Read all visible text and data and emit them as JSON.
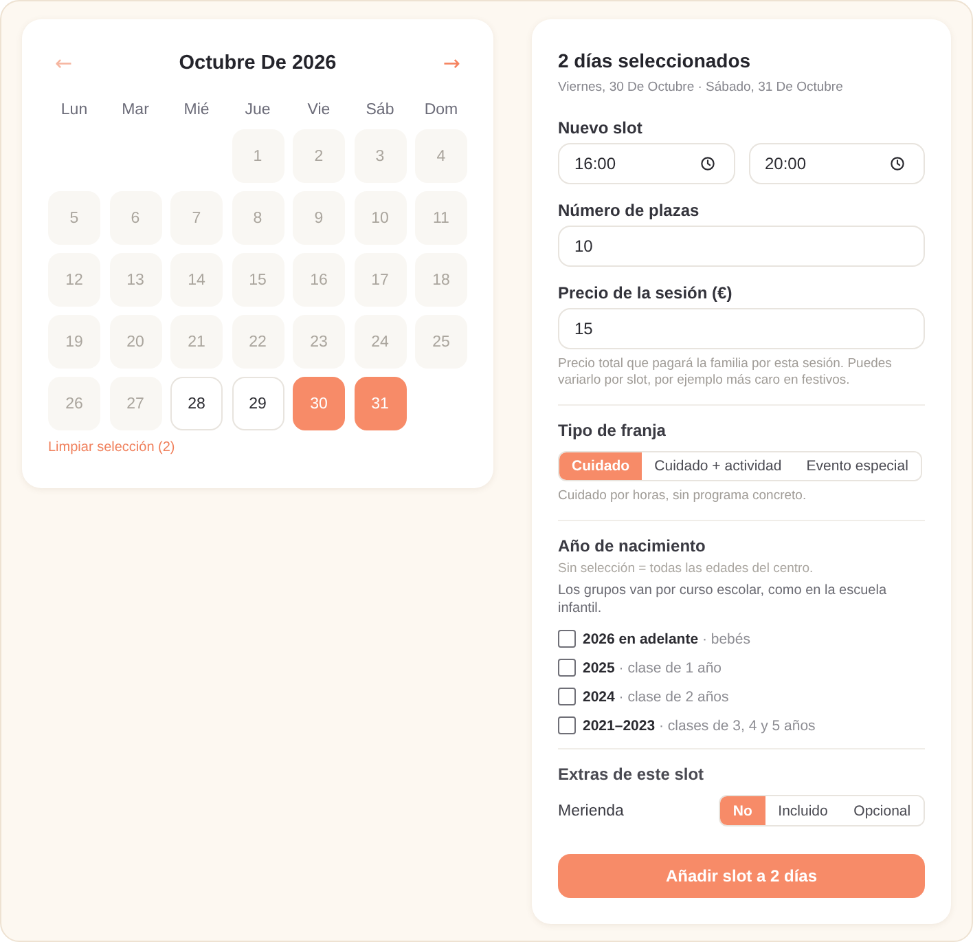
{
  "calendar": {
    "prev": {
      "symbol": "←",
      "disabled": true
    },
    "title": "Octubre De 2026",
    "next": {
      "symbol": "→",
      "disabled": false
    },
    "weekdays": [
      "Lun",
      "Mar",
      "Mié",
      "Jue",
      "Vie",
      "Sáb",
      "Dom"
    ],
    "weeks": [
      {
        "days": [
          {
            "label": "1",
            "disabled": true,
            "selected": false
          },
          {
            "label": "2",
            "disabled": true,
            "selected": false
          },
          {
            "label": "3",
            "disabled": true,
            "selected": false
          },
          {
            "label": "4",
            "disabled": true,
            "selected": false
          }
        ]
      },
      {
        "days": [
          {
            "label": "5",
            "disabled": true,
            "selected": false
          },
          {
            "label": "6",
            "disabled": true,
            "selected": false
          },
          {
            "label": "7",
            "disabled": true,
            "selected": false
          },
          {
            "label": "8",
            "disabled": true,
            "selected": false
          },
          {
            "label": "9",
            "disabled": true,
            "selected": false
          },
          {
            "label": "10",
            "disabled": true,
            "selected": false
          },
          {
            "label": "11",
            "disabled": true,
            "selected": false
          }
        ]
      },
      {
        "days": [
          {
            "label": "12",
            "disabled": true,
            "selected": false
          },
          {
            "label": "13",
            "disabled": true,
            "selected": false
          },
          {
            "label": "14",
            "disabled": true,
            "selected": false
          },
          {
            "label": "15",
            "disabled": true,
            "selected": false
          },
          {
            "label": "16",
            "disabled": true,
            "selected": false
          },
          {
            "label": "17",
            "disabled": true,
            "selected": false
          },
          {
            "label": "18",
            "disabled": true,
            "selected": false
          }
        ]
      },
      {
        "days": [
          {
            "label": "19",
            "disabled": true,
            "selected": false
          },
          {
            "label": "20",
            "disabled": true,
            "selected": false
          },
          {
            "label": "21",
            "disabled": true,
            "selected": false
          },
          {
            "label": "22",
            "disabled": true,
            "selected": false
          },
          {
            "label": "23",
            "disabled": true,
            "selected": false
          },
          {
            "label": "24",
            "disabled": true,
            "selected": false
          },
          {
            "label": "25",
            "disabled": true,
            "selected": false
          }
        ]
      },
      {
        "days": [
          {
            "label": "26",
            "disabled": true,
            "selected": false
          },
          {
            "label": "27",
            "disabled": true,
            "selected": false
          },
          {
            "label": "28",
            "disabled": false,
            "selected": false
          },
          {
            "label": "29",
            "disabled": false,
            "selected": false
          },
          {
            "label": "30",
            "disabled": false,
            "selected": true
          },
          {
            "label": "31",
            "disabled": false,
            "selected": true
          }
        ]
      }
    ],
    "clear_link": "Limpiar selección (2)"
  },
  "panel": {
    "title": "2 días seleccionados",
    "subtitle": "Viernes, 30 De Octubre · Sábado, 31 De Octubre",
    "slot": {
      "label": "Nuevo slot",
      "start": "16:00",
      "end": "20:00"
    },
    "places": {
      "label": "Número de plazas",
      "value": "10"
    },
    "price": {
      "label": "Precio de la sesión (€)",
      "value": "15",
      "help": "Precio total que pagará la familia por esta sesión. Puedes variarlo por slot, por ejemplo más caro en festivos."
    },
    "slot_type": {
      "label": "Tipo de franja",
      "options": [
        {
          "label": "Cuidado",
          "selected": true
        },
        {
          "label": "Cuidado + actividad",
          "selected": false
        },
        {
          "label": "Evento especial",
          "selected": false
        }
      ],
      "help": "Cuidado por horas, sin programa concreto."
    },
    "birth_year": {
      "label": "Año de nacimiento",
      "hint": "Sin selección = todas las edades del centro.",
      "note": "Los grupos van por curso escolar, como en la escuela infantil.",
      "options": [
        {
          "label": "**2026 en adelante** · bebés",
          "checked": false
        },
        {
          "label": "**2025** · clase de 1 año",
          "checked": false
        },
        {
          "label": "**2024** · clase de 2 años",
          "checked": false
        },
        {
          "label": "**2021–2023** · clases de 3, 4 y 5 años",
          "checked": false
        }
      ]
    },
    "extras": {
      "label": "Extras de este slot",
      "items": [
        {
          "label": "Merienda",
          "options": [
            {
              "label": "No",
              "selected": true
            },
            {
              "label": "Incluido",
              "selected": false
            },
            {
              "label": "Opcional",
              "selected": false
            }
          ]
        }
      ]
    },
    "submit": "Añadir slot a 2 días"
  }
}
